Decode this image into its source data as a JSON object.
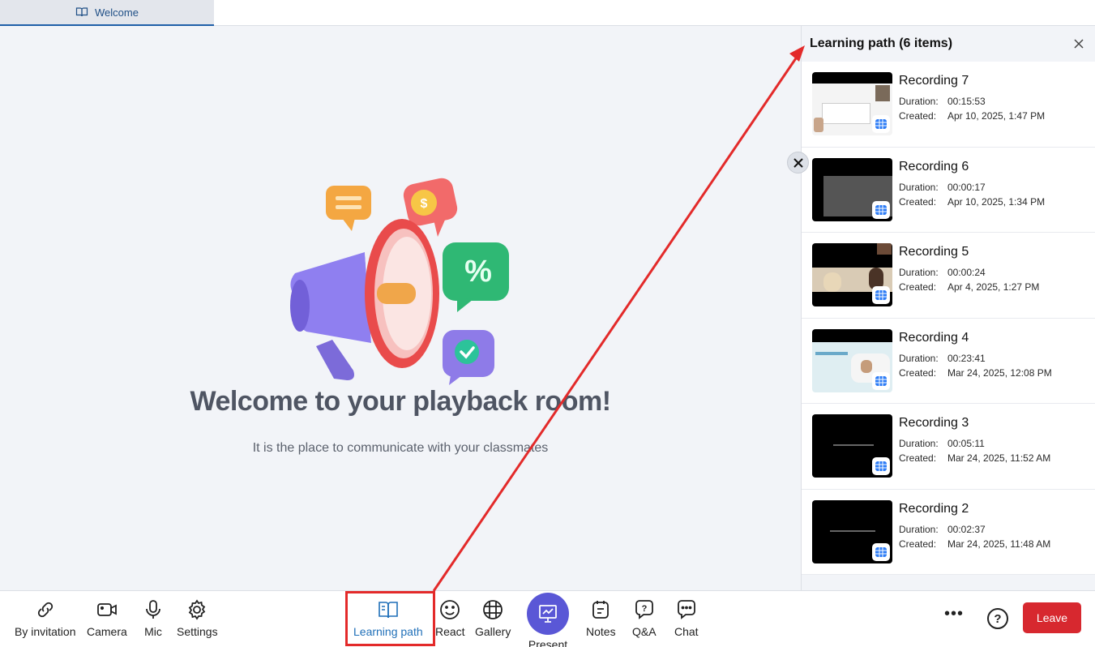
{
  "tabs": [
    {
      "label": "Welcome",
      "icon": "book-open-icon"
    }
  ],
  "stage": {
    "title": "Welcome to your playback room!",
    "subtitle": "It is the place to communicate with your classmates"
  },
  "panel": {
    "title": "Learning path (6 items)",
    "duration_key": "Duration:",
    "created_key": "Created:",
    "items": [
      {
        "title": "Recording 7",
        "duration": "00:15:53",
        "created": "Apr 10, 2025, 1:47 PM"
      },
      {
        "title": "Recording 6",
        "duration": "00:00:17",
        "created": "Apr 10, 2025, 1:34 PM"
      },
      {
        "title": "Recording 5",
        "duration": "00:00:24",
        "created": "Apr 4, 2025, 1:27 PM"
      },
      {
        "title": "Recording 4",
        "duration": "00:23:41",
        "created": "Mar 24, 2025, 12:08 PM"
      },
      {
        "title": "Recording 3",
        "duration": "00:05:11",
        "created": "Mar 24, 2025, 11:52 AM"
      },
      {
        "title": "Recording 2",
        "duration": "00:02:37",
        "created": "Mar 24, 2025, 11:48 AM"
      }
    ]
  },
  "toolbar": {
    "by_invitation": "By invitation",
    "camera": "Camera",
    "mic": "Mic",
    "settings": "Settings",
    "learning_path": "Learning path",
    "react": "React",
    "gallery": "Gallery",
    "present": "Present",
    "notes": "Notes",
    "qa": "Q&A",
    "chat": "Chat",
    "more": "•••",
    "help": "?",
    "leave": "Leave"
  },
  "colors": {
    "accent": "#1f6fb8",
    "present": "#5a57d6",
    "leave": "#d7282f",
    "annotation": "#e32a2a"
  }
}
